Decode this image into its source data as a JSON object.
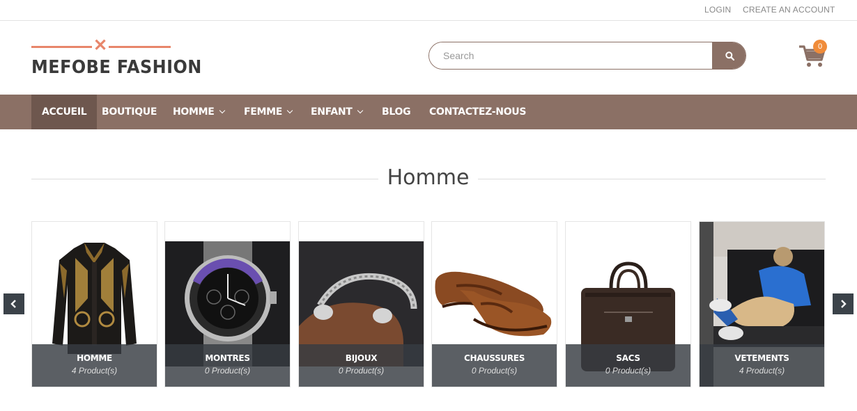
{
  "topbar": {
    "login": "LOGIN",
    "create_account": "CREATE AN ACCOUNT"
  },
  "header": {
    "logo_text": "MEFOBE FASHION",
    "search_placeholder": "Search",
    "cart_count": "0",
    "accent_color": "#8b7065",
    "badge_color": "#f08c3a",
    "logo_accent_color": "#e8866b"
  },
  "nav": {
    "items": [
      {
        "label": "ACCUEIL",
        "active": true
      },
      {
        "label": "BOUTIQUE"
      },
      {
        "label": "HOMME",
        "dropdown": true
      },
      {
        "label": "FEMME",
        "dropdown": true
      },
      {
        "label": "ENFANT",
        "dropdown": true
      },
      {
        "label": "BLOG"
      },
      {
        "label": "CONTACTEZ-NOUS"
      }
    ]
  },
  "section": {
    "title": "Homme"
  },
  "categories": [
    {
      "name": "HOMME",
      "count": "4 Product(s)",
      "icon": "shirt-image"
    },
    {
      "name": "MONTRES",
      "count": "0 Product(s)",
      "icon": "watch-image"
    },
    {
      "name": "BIJOUX",
      "count": "0 Product(s)",
      "icon": "bracelet-image"
    },
    {
      "name": "CHAUSSURES",
      "count": "0 Product(s)",
      "icon": "loafer-image"
    },
    {
      "name": "SACS",
      "count": "0 Product(s)",
      "icon": "bag-image"
    },
    {
      "name": "VETEMENTS",
      "count": "4 Product(s)",
      "icon": "clothing-photo"
    }
  ]
}
